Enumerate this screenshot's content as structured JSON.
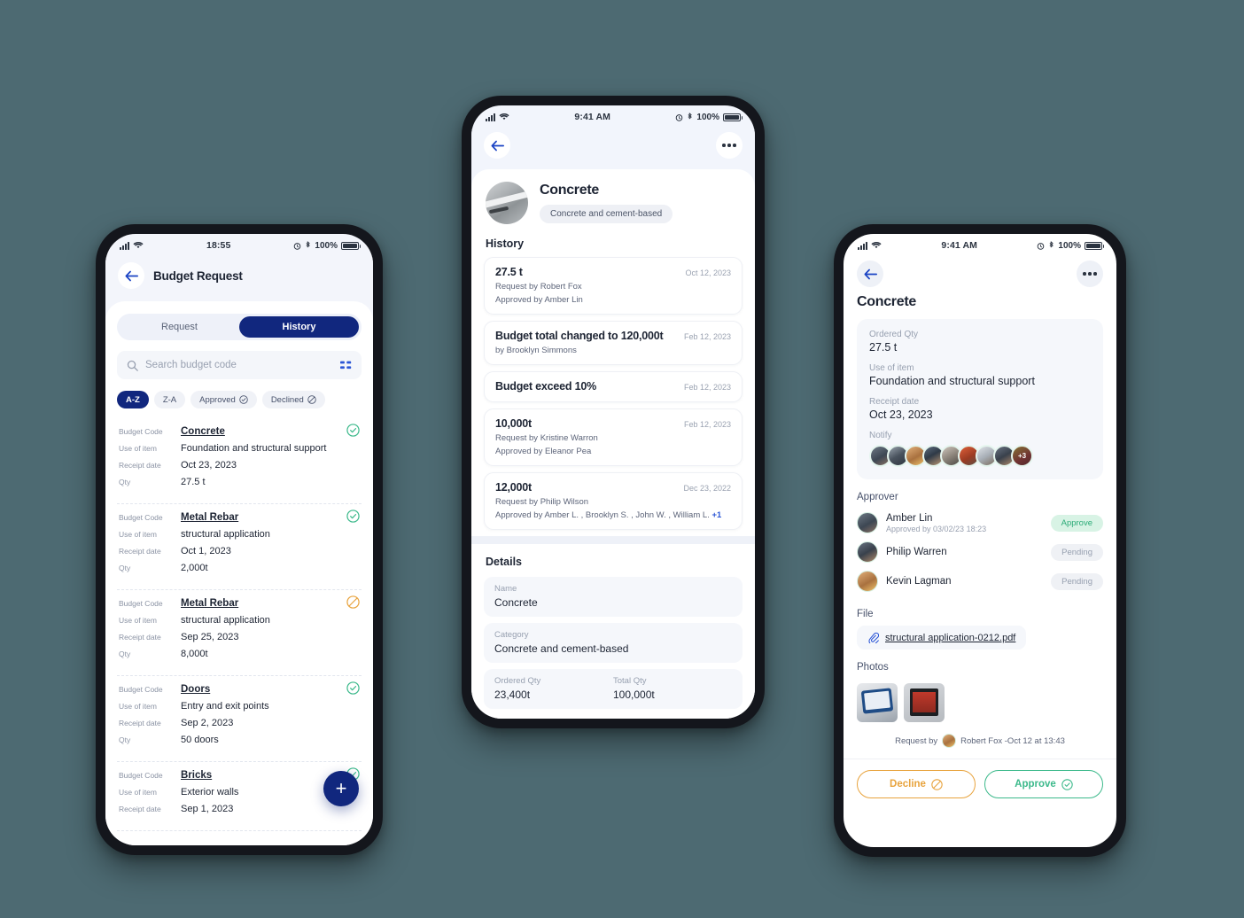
{
  "theme": {
    "background": "#4d6a72",
    "primary": "#11277e",
    "accent_blue": "#2a55d6",
    "approve_green": "#3cb98b",
    "decline_orange": "#e8a33d"
  },
  "phone_left": {
    "status": {
      "time": "18:55",
      "battery": "100%",
      "signal_icon": "cellular-bars-icon",
      "wifi_icon": "wifi-icon",
      "alarm_icon": "alarm-icon",
      "bluetooth_icon": "bluetooth-icon"
    },
    "header": {
      "back_icon": "back-arrow-icon",
      "title": "Budget Request"
    },
    "tabs": [
      {
        "label": "Request",
        "active": false
      },
      {
        "label": "History",
        "active": true
      }
    ],
    "search": {
      "placeholder": "Search budget code",
      "value": "",
      "search_icon": "search-icon",
      "filter_icon": "filter-sort-icon"
    },
    "filters": [
      {
        "label": "A-Z",
        "active": true,
        "icon": ""
      },
      {
        "label": "Z-A",
        "active": false,
        "icon": ""
      },
      {
        "label": "Approved",
        "active": false,
        "icon": "check-circle-icon"
      },
      {
        "label": "Declined",
        "active": false,
        "icon": "ban-circle-icon"
      }
    ],
    "row_labels": {
      "code": "Budget Code",
      "use": "Use of item",
      "receipt": "Receipt date",
      "qty": "Qty"
    },
    "items": [
      {
        "code": "Concrete",
        "use": "Foundation and structural support",
        "receipt": "Oct 23, 2023",
        "qty": "27.5 t",
        "status": "approved"
      },
      {
        "code": "Metal Rebar",
        "use": "structural application",
        "receipt": "Oct 1, 2023",
        "qty": "2,000t",
        "status": "approved"
      },
      {
        "code": "Metal Rebar",
        "use": "structural application",
        "receipt": "Sep 25, 2023",
        "qty": "8,000t",
        "status": "declined"
      },
      {
        "code": "Doors",
        "use": "Entry and exit points",
        "receipt": "Sep 2, 2023",
        "qty": "50 doors",
        "status": "approved"
      },
      {
        "code": "Bricks",
        "use": "Exterior walls",
        "receipt": "Sep 1, 2023",
        "qty": "",
        "status": "approved"
      }
    ],
    "fab": {
      "label": "+",
      "icon": "plus-icon"
    }
  },
  "phone_mid": {
    "status": {
      "time": "9:41 AM",
      "battery": "100%"
    },
    "topbar": {
      "back_icon": "back-arrow-icon",
      "more_icon": "more-dots-icon"
    },
    "hero": {
      "title": "Concrete",
      "tag": "Concrete and cement-based",
      "image": "concrete-thumbnail"
    },
    "history_title": "History",
    "history": [
      {
        "amount": "27.5 t",
        "date": "Oct 12, 2023",
        "line1": "Request by Robert Fox",
        "line2": "Approved by Amber Lin",
        "extra": ""
      },
      {
        "amount": "Budget total changed to 120,000t",
        "date": "Feb 12, 2023",
        "line1": "by Brooklyn Simmons",
        "line2": "",
        "extra": ""
      },
      {
        "amount": "Budget exceed 10%",
        "date": "Feb 12, 2023",
        "line1": "",
        "line2": "",
        "extra": ""
      },
      {
        "amount": "10,000t",
        "date": "Feb 12, 2023",
        "line1": "Request by Kristine Warron",
        "line2": "Approved by Eleanor Pea",
        "extra": ""
      },
      {
        "amount": "12,000t",
        "date": "Dec 23, 2022",
        "line1": "Request by Philip Wilson",
        "line2": "Approved by Amber L. , Brooklyn S. , John W. , William L.",
        "extra": "+1"
      }
    ],
    "details_title": "Details",
    "details": [
      {
        "label": "Name",
        "value": "Concrete"
      },
      {
        "label": "Category",
        "value": "Concrete and cement-based"
      }
    ],
    "qty": [
      {
        "label": "Ordered Qty",
        "value": "23,400t"
      },
      {
        "label": "Total Qty",
        "value": "100,000t"
      }
    ]
  },
  "phone_right": {
    "status": {
      "time": "9:41 AM",
      "battery": "100%"
    },
    "topbar": {
      "back_icon": "back-arrow-icon",
      "more_icon": "more-dots-icon"
    },
    "title": "Concrete",
    "summary": [
      {
        "label": "Ordered Qty",
        "value": "27.5 t"
      },
      {
        "label": "Use of item",
        "value": "Foundation and structural support"
      },
      {
        "label": "Receipt date",
        "value": "Oct 23, 2023"
      }
    ],
    "notify": {
      "label": "Notify",
      "overflow": "+3",
      "count": 9
    },
    "approver_title": "Approver",
    "approvers": [
      {
        "name": "Amber Lin",
        "sub": "Approved by 03/02/23 18:23",
        "status": "Approve",
        "state": "approve"
      },
      {
        "name": "Philip Warren",
        "sub": "",
        "status": "Pending",
        "state": "pending"
      },
      {
        "name": "Kevin Lagman",
        "sub": "",
        "status": "Pending",
        "state": "pending"
      }
    ],
    "file_title": "File",
    "file": {
      "name": "structural application-0212.pdf",
      "icon": "paperclip-icon"
    },
    "photos_title": "Photos",
    "photos": [
      "photo-tablet-thumbnail",
      "photo-machine-thumbnail"
    ],
    "request_line": "Request by",
    "request_person": "Robert Fox -Oct 12 at 13:43",
    "actions": [
      {
        "label": "Decline",
        "icon": "ban-circle-icon",
        "kind": "decline"
      },
      {
        "label": "Approve",
        "icon": "check-circle-icon",
        "kind": "approve"
      }
    ]
  }
}
